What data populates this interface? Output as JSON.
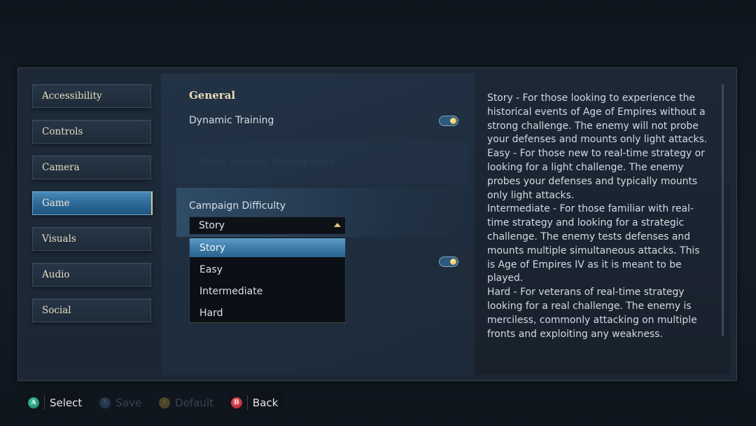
{
  "sidebar": {
    "items": [
      {
        "label": "Accessibility",
        "active": false
      },
      {
        "label": "Controls",
        "active": false
      },
      {
        "label": "Camera",
        "active": false
      },
      {
        "label": "Game",
        "active": true
      },
      {
        "label": "Visuals",
        "active": false
      },
      {
        "label": "Audio",
        "active": false
      },
      {
        "label": "Social",
        "active": false
      }
    ]
  },
  "main": {
    "section_title": "General",
    "dynamic_training": {
      "label": "Dynamic Training",
      "enabled": true
    },
    "reset_hints": {
      "label": "Reset Dynamic Training Hints",
      "disabled": true
    },
    "campaign_difficulty": {
      "label": "Campaign Difficulty",
      "selected": "Story",
      "options": [
        "Story",
        "Easy",
        "Intermediate",
        "Hard"
      ],
      "expanded": true
    },
    "hidden_setting_toggle": {
      "enabled": true
    }
  },
  "description": {
    "paragraphs": [
      "Story - For those looking to experience the historical events of Age of Empires without a strong challenge. The enemy will not probe your defenses and mounts only light attacks.",
      "Easy - For those new to real-time strategy or looking for a light challenge. The enemy probes your defenses and typically mounts only light attacks.",
      "Intermediate - For those familiar with real-time strategy and looking for a strategic challenge. The enemy tests defenses and mounts multiple simultaneous attacks. This is Age of Empires IV as it is meant to be played.",
      "Hard - For veterans of real-time strategy looking for a real challenge. The enemy is merciless, commonly attacking on multiple fronts and exploiting any weakness."
    ]
  },
  "footer": {
    "hints": [
      {
        "button": "A",
        "label": "Select",
        "enabled": true,
        "color": "#2aa68a"
      },
      {
        "button": "X",
        "label": "Save",
        "enabled": false,
        "color": "#243447"
      },
      {
        "button": "Y",
        "label": "Default",
        "enabled": false,
        "color": "#4a4526"
      },
      {
        "button": "B",
        "label": "Back",
        "enabled": true,
        "color": "#d23a40"
      }
    ]
  },
  "colors": {
    "accent_gold": "#e8dcb8",
    "active_tab_blue": "#2f6d9a",
    "toggle_on": "#2b5a7e"
  }
}
